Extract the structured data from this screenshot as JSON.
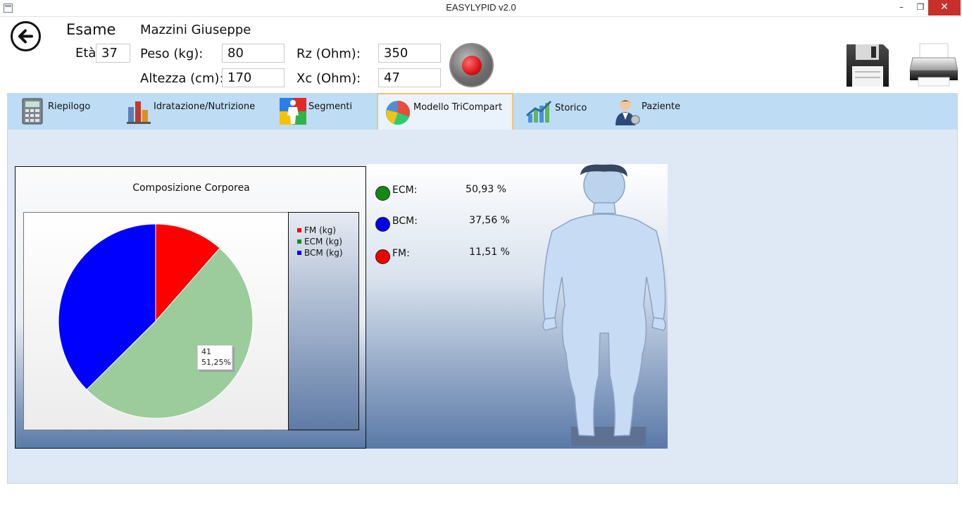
{
  "window": {
    "title": "EASYLYPID v2.0",
    "minimize": "–",
    "maximize": "❐",
    "close": "✕"
  },
  "header": {
    "exam_label": "Esame",
    "patient_name": "Mazzini Giuseppe",
    "age_label": "Età:",
    "age_value": "37",
    "weight_label": "Peso (kg):",
    "weight_value": "80",
    "height_label": "Altezza (cm):",
    "height_value": "170",
    "rz_label": "Rz (Ohm):",
    "rz_value": "350",
    "xc_label": "Xc (Ohm):",
    "xc_value": "47"
  },
  "icons": {
    "back": "back-arrow-icon",
    "record": "record-icon",
    "save": "floppy-disk-icon",
    "print": "printer-icon"
  },
  "tabs": [
    {
      "label": "Riepilogo",
      "icon": "calculator-icon"
    },
    {
      "label": "Idratazione/Nutrizione",
      "icon": "bar-chart-icon"
    },
    {
      "label": "Segmenti",
      "icon": "body-segments-icon"
    },
    {
      "label": "Modello TriCompart",
      "icon": "pie-chart-icon",
      "active": true
    },
    {
      "label": "Storico",
      "icon": "trend-chart-icon"
    },
    {
      "label": "Paziente",
      "icon": "patient-icon"
    }
  ],
  "colors": {
    "fm": "#ff0000",
    "ecm": "#9ccc9c",
    "bcm": "#0000ff",
    "tab_bar": "#bfdcf5",
    "active_tab_border": "#e8c777"
  },
  "chart_data": {
    "type": "pie",
    "title": "Composizione Corporea",
    "categories": [
      "FM (kg)",
      "ECM (kg)",
      "BCM (kg)"
    ],
    "values": [
      9.21,
      41,
      30.05
    ],
    "legend_position": "right",
    "tooltip": {
      "value": "41",
      "percent": "51,25%"
    }
  },
  "stats": [
    {
      "label": "ECM:",
      "value": "50,93 %",
      "color": "#138a13"
    },
    {
      "label": "BCM:",
      "value": "37,56 %",
      "color": "#0000ee"
    },
    {
      "label": "FM:",
      "value": "11,51 %",
      "color": "#ee0000"
    }
  ]
}
